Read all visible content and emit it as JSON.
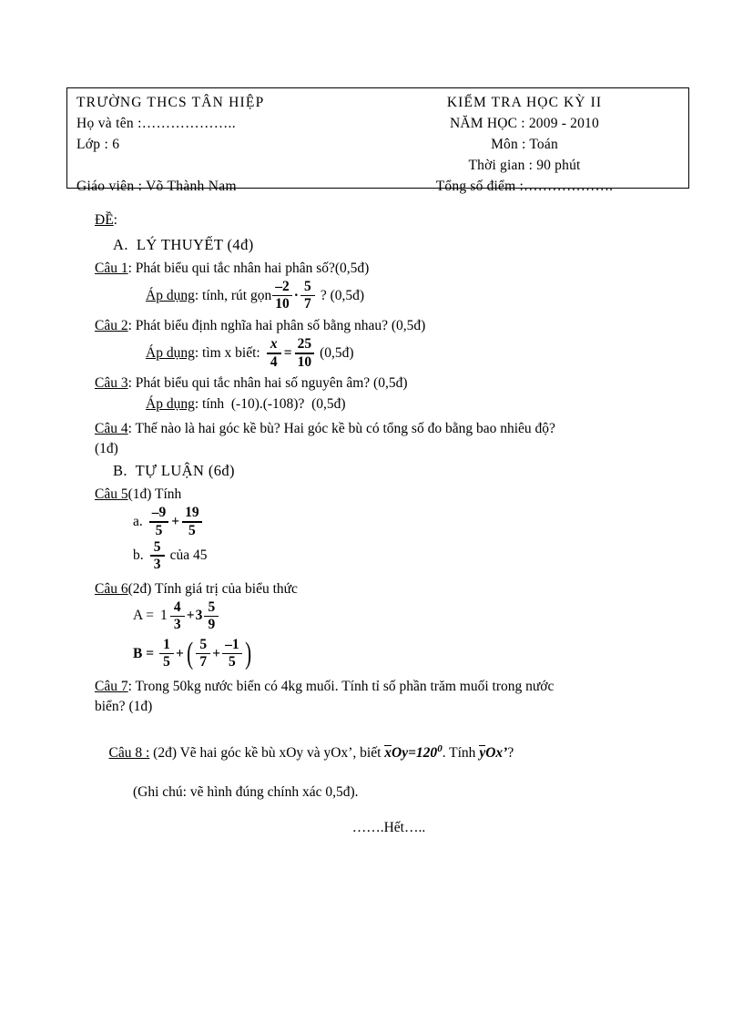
{
  "header": {
    "school": "TRƯỜNG THCS TÂN HIỆP",
    "name_field": "Họ và tên :………………..",
    "class_field": "Lớp : 6",
    "teacher": "Giáo viên : Võ Thành Nam",
    "exam_title": "KIỂM TRA HỌC KỲ II",
    "school_year": "NĂM HỌC : 2009 - 2010",
    "subject": "Môn : Toán",
    "duration": "Thời gian : 90 phút",
    "total_score": "Tổng số điểm :………………."
  },
  "body": {
    "de_label": "ĐỀ",
    "de_colon": ":",
    "section_a": "A.  LÝ THUYẾT (4đ)",
    "section_b": "B.  TỰ LUẬN (6đ)",
    "q1": {
      "label": "Câu 1",
      "text": ": Phát biểu qui tắc nhân hai phân số?(0,5đ)",
      "apply_label": "Áp dụng",
      "apply_text": ": tính, rút gọn",
      "f1_num": "–2",
      "f1_den": "10",
      "op": "·",
      "f2_num": "5",
      "f2_den": "7",
      "tail": "? (0,5đ)"
    },
    "q2": {
      "label": "Câu 2",
      "text": ": Phát biểu định nghĩa hai phân số bằng nhau? (0,5đ)",
      "apply_label": "Áp dụng",
      "apply_text": ": tìm x biết:",
      "f1_num": "x",
      "f1_den": "4",
      "op": "=",
      "f2_num": "25",
      "f2_den": "10",
      "tail": "(0,5đ)"
    },
    "q3": {
      "label": "Câu 3",
      "text": ": Phát biểu qui tắc nhân hai số nguyên âm? (0,5đ)",
      "apply_label": "Áp dụng",
      "apply_text": ": tính  (-10).(-108)?  (0,5đ)"
    },
    "q4": {
      "label": "Câu 4",
      "text": ": Thế nào là hai góc kề bù? Hai góc kề bù có tổng số đo bằng bao nhiêu độ?",
      "text2": "(1đ)"
    },
    "q5": {
      "label": "Câu 5",
      "text": "(1đ) Tính",
      "a_label": "a.",
      "a_f1_num": "–9",
      "a_f1_den": "5",
      "a_op": "+",
      "a_f2_num": "19",
      "a_f2_den": "5",
      "b_label": "b.",
      "b_num": "5",
      "b_den": "3",
      "b_tail": "của 45"
    },
    "q6": {
      "label": "Câu 6",
      "text": "(2đ) Tính giá trị của biểu thức",
      "a_lead": "A =",
      "a_w1": "1",
      "a_f1_num": "4",
      "a_f1_den": "3",
      "a_op": "+",
      "a_w2": "3",
      "a_f2_num": "5",
      "a_f2_den": "9",
      "b_lead": "B =",
      "b_f1_num": "1",
      "b_f1_den": "5",
      "b_op1": "+",
      "b_f2_num": "5",
      "b_f2_den": "7",
      "b_op2": "+",
      "b_f3_num": "–1",
      "b_f3_den": "5"
    },
    "q7": {
      "label": "Câu 7",
      "text": ": Trong 50kg nước biển có 4kg muối. Tính tỉ số phần trăm muối trong nước",
      "text2": "biển? (1đ)"
    },
    "q8": {
      "label": "Câu 8 :",
      "text_before": " (2đ) Vẽ hai góc kề bù xOy và yOx’, biết ",
      "angle1_first": "x",
      "angle1_rest": "Oy",
      "angle1_eq": "=120",
      "angle1_sup": "0",
      "text_mid": ". Tính ",
      "angle2_first": "y",
      "angle2_rest": "Ox’",
      "text_after": "?",
      "note": "(Ghi chú: vẽ hình đúng chính xác 0,5đ)."
    },
    "footer": "…….Hết….."
  }
}
